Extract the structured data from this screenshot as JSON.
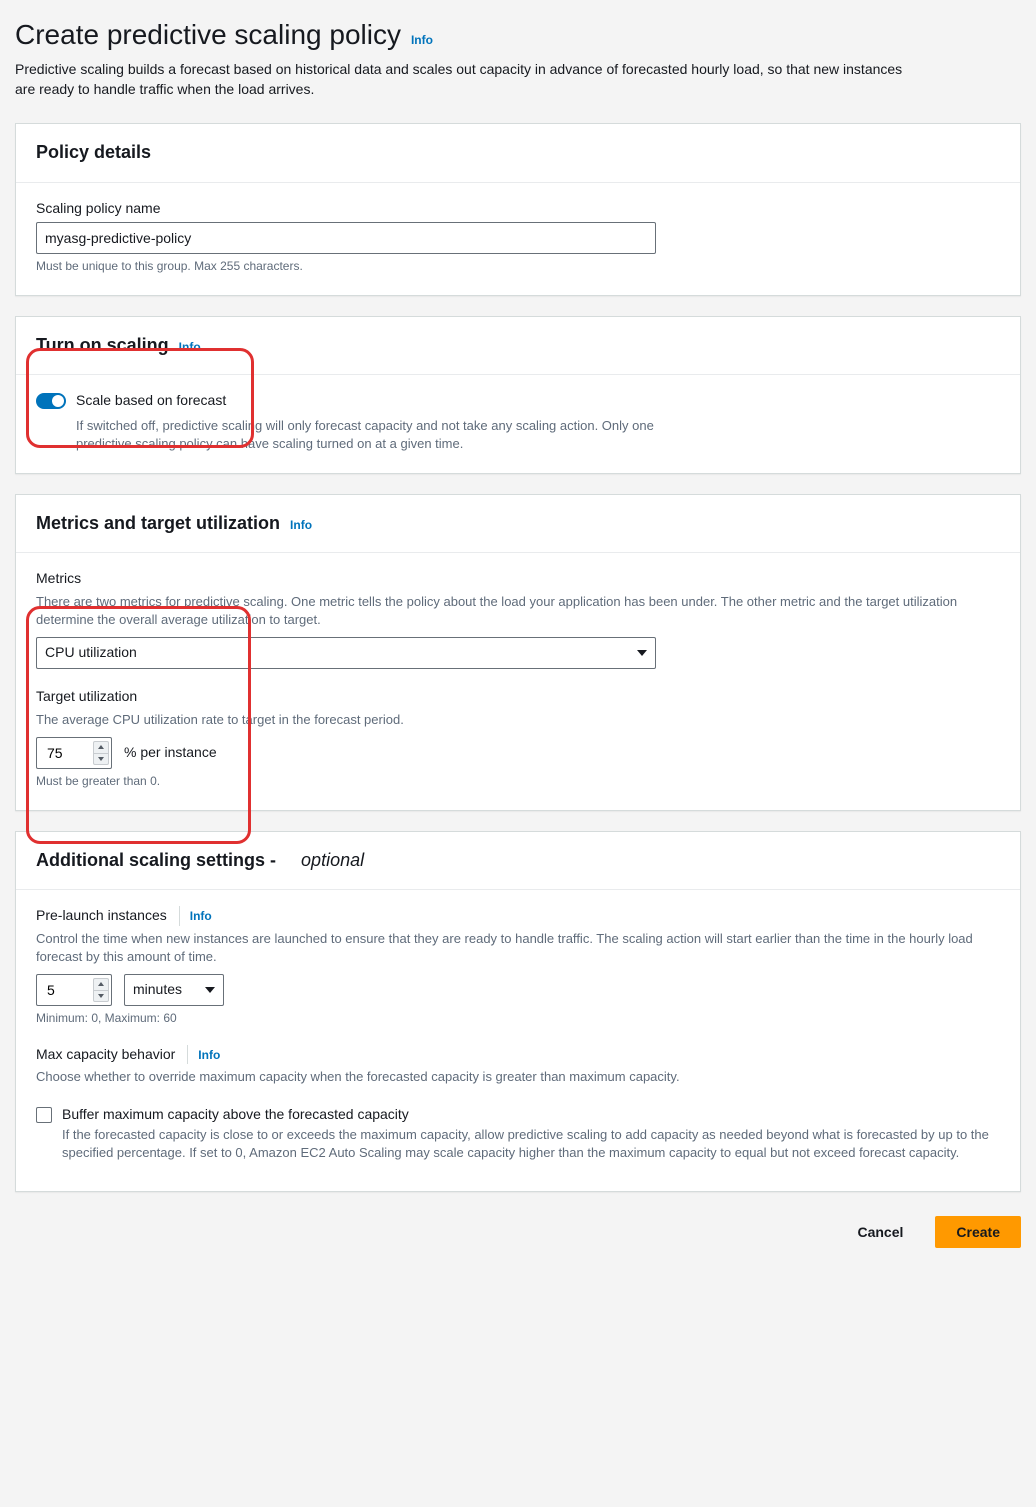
{
  "page": {
    "title": "Create predictive scaling policy",
    "info": "Info",
    "description": "Predictive scaling builds a forecast based on historical data and scales out capacity in advance of forecasted hourly load, so that new instances are ready to handle traffic when the load arrives."
  },
  "policy_details": {
    "heading": "Policy details",
    "name_label": "Scaling policy name",
    "name_value": "myasg-predictive-policy",
    "name_hint": "Must be unique to this group. Max 255 characters."
  },
  "turn_on_scaling": {
    "heading": "Turn on scaling",
    "info": "Info",
    "toggle_label": "Scale based on forecast",
    "toggle_desc": "If switched off, predictive scaling will only forecast capacity and not take any scaling action. Only one predictive scaling policy can have scaling turned on at a given time."
  },
  "metrics": {
    "heading": "Metrics and target utilization",
    "info": "Info",
    "metrics_label": "Metrics",
    "metrics_desc": "There are two metrics for predictive scaling. One metric tells the policy about the load your application has been under. The other metric and the target utilization determine the overall average utilization to target.",
    "metric_selected": "CPU utilization",
    "target_label": "Target utilization",
    "target_desc": "The average CPU utilization rate to target in the forecast period.",
    "target_value": "75",
    "target_unit": "% per instance",
    "target_hint": "Must be greater than 0."
  },
  "additional": {
    "heading_main": "Additional scaling settings -",
    "heading_optional": "optional",
    "prelaunch_label": "Pre-launch instances",
    "prelaunch_info": "Info",
    "prelaunch_desc": "Control the time when new instances are launched to ensure that they are ready to handle traffic. The scaling action will start earlier than the time in the hourly load forecast by this amount of time.",
    "prelaunch_value": "5",
    "prelaunch_unit": "minutes",
    "prelaunch_hint": "Minimum: 0, Maximum: 60",
    "maxcap_label": "Max capacity behavior",
    "maxcap_info": "Info",
    "maxcap_desc": "Choose whether to override maximum capacity when the forecasted capacity is greater than maximum capacity.",
    "buffer_label": "Buffer maximum capacity above the forecasted capacity",
    "buffer_desc": "If the forecasted capacity is close to or exceeds the maximum capacity, allow predictive scaling to add capacity as needed beyond what is forecasted by up to the specified percentage. If set to 0, Amazon EC2 Auto Scaling may scale capacity higher than the maximum capacity to equal but not exceed forecast capacity."
  },
  "footer": {
    "cancel": "Cancel",
    "create": "Create"
  }
}
